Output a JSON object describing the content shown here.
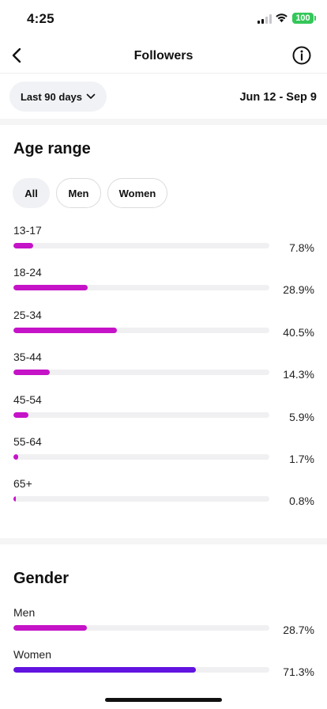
{
  "status_bar": {
    "time": "4:25",
    "battery": "100"
  },
  "nav": {
    "title": "Followers"
  },
  "filter": {
    "range_label": "Last 90 days",
    "date_range": "Jun 12 - Sep 9"
  },
  "age": {
    "title": "Age range",
    "tabs": [
      "All",
      "Men",
      "Women"
    ],
    "selected_tab": "All",
    "bar_color": "#c513c8",
    "rows": [
      {
        "label": "13-17",
        "pct_text": "7.8%",
        "value": 7.8
      },
      {
        "label": "18-24",
        "pct_text": "28.9%",
        "value": 28.9
      },
      {
        "label": "25-34",
        "pct_text": "40.5%",
        "value": 40.5
      },
      {
        "label": "35-44",
        "pct_text": "14.3%",
        "value": 14.3
      },
      {
        "label": "45-54",
        "pct_text": "5.9%",
        "value": 5.9
      },
      {
        "label": "55-64",
        "pct_text": "1.7%",
        "value": 1.7
      },
      {
        "label": "65+",
        "pct_text": "0.8%",
        "value": 0.8
      }
    ]
  },
  "gender": {
    "title": "Gender",
    "rows": [
      {
        "label": "Men",
        "pct_text": "28.7%",
        "value": 28.7,
        "color": "#c513c8"
      },
      {
        "label": "Women",
        "pct_text": "71.3%",
        "value": 71.3,
        "color": "#6113e0"
      }
    ]
  }
}
